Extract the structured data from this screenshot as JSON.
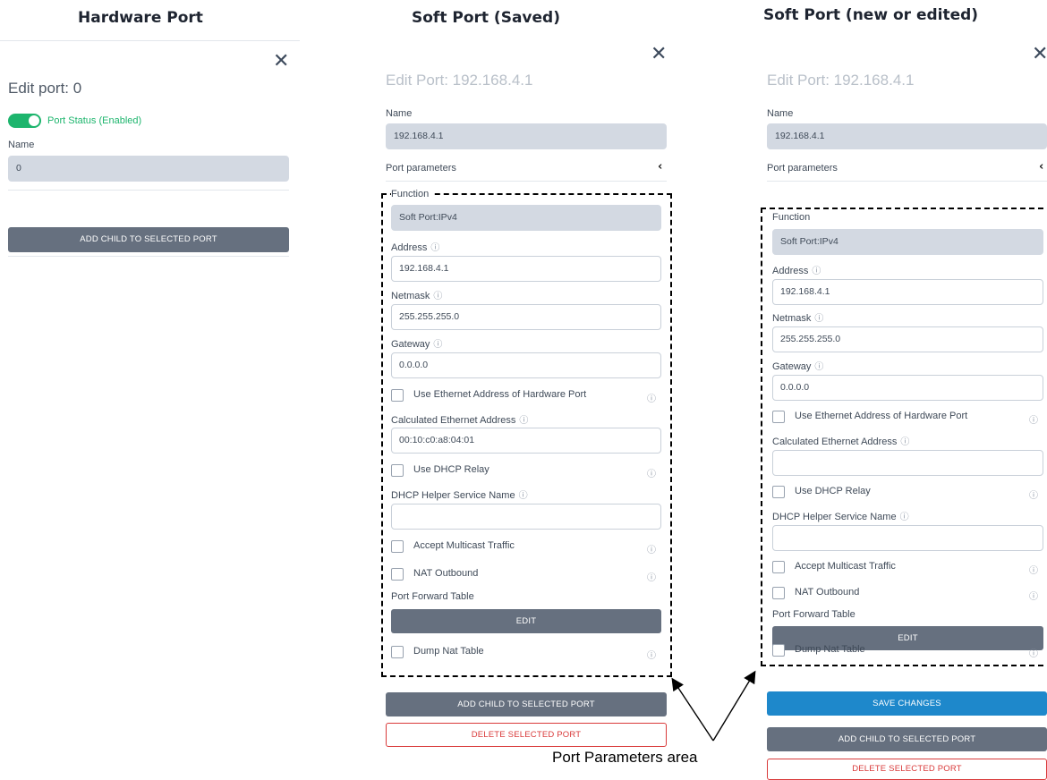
{
  "headings": {
    "col1": "Hardware Port",
    "col2": "Soft Port (Saved)",
    "col3": "Soft Port (new or edited)"
  },
  "col1": {
    "close_icon": "close-icon",
    "edit_title": "Edit port: 0",
    "toggle_label": "Port Status (Enabled)",
    "toggle_on": true,
    "name_label": "Name",
    "name_value": "0",
    "add_child": "ADD CHILD TO SELECTED PORT"
  },
  "col2": {
    "edit_title": "Edit Port: 192.168.4.1",
    "name_label": "Name",
    "name_value": "192.168.4.1",
    "params_label": "Port parameters",
    "function_label": "Function",
    "function_value": "Soft Port:IPv4",
    "address_label": "Address",
    "address_value": "192.168.4.1",
    "netmask_label": "Netmask",
    "netmask_value": "255.255.255.0",
    "gateway_label": "Gateway",
    "gateway_value": "0.0.0.0",
    "use_eth_label": "Use Ethernet Address of Hardware Port",
    "calc_eth_label": "Calculated Ethernet Address",
    "calc_eth_value": "00:10:c0:a8:04:01",
    "dhcp_relay_label": "Use DHCP Relay",
    "dhcp_helper_label": "DHCP Helper Service Name",
    "dhcp_helper_value": "",
    "multicast_label": "Accept Multicast Traffic",
    "nat_label": "NAT Outbound",
    "pft_label": "Port Forward Table",
    "edit_btn": "EDIT",
    "dump_nat_label": "Dump Nat Table",
    "add_child": "ADD CHILD TO SELECTED PORT",
    "delete": "DELETE SELECTED PORT"
  },
  "col3": {
    "edit_title": "Edit Port: 192.168.4.1",
    "name_label": "Name",
    "name_value": "192.168.4.1",
    "params_label": "Port parameters",
    "function_label": "Function",
    "function_value": "Soft Port:IPv4",
    "address_label": "Address",
    "address_value": "192.168.4.1",
    "netmask_label": "Netmask",
    "netmask_value": "255.255.255.0",
    "gateway_label": "Gateway",
    "gateway_value": "0.0.0.0",
    "use_eth_label": "Use Ethernet Address of Hardware Port",
    "calc_eth_label": "Calculated Ethernet Address",
    "calc_eth_value": "",
    "dhcp_relay_label": "Use DHCP Relay",
    "dhcp_helper_label": "DHCP Helper Service Name",
    "dhcp_helper_value": "",
    "multicast_label": "Accept Multicast Traffic",
    "nat_label": "NAT Outbound",
    "pft_label": "Port Forward Table",
    "edit_btn": "EDIT",
    "dump_nat_label": "Dump Nat Table",
    "save": "SAVE CHANGES",
    "add_child": "ADD CHILD TO SELECTED PORT",
    "delete": "DELETE SELECTED PORT"
  },
  "annotation": "Port Parameters area",
  "icons": {
    "close": "close-icon",
    "info": "info-icon",
    "chevron": "chevron-left-icon"
  },
  "colors": {
    "accent_green": "#1db56d",
    "primary_blue": "#1e88cb",
    "danger_red": "#d93a3a",
    "button_gray": "#66707f"
  }
}
